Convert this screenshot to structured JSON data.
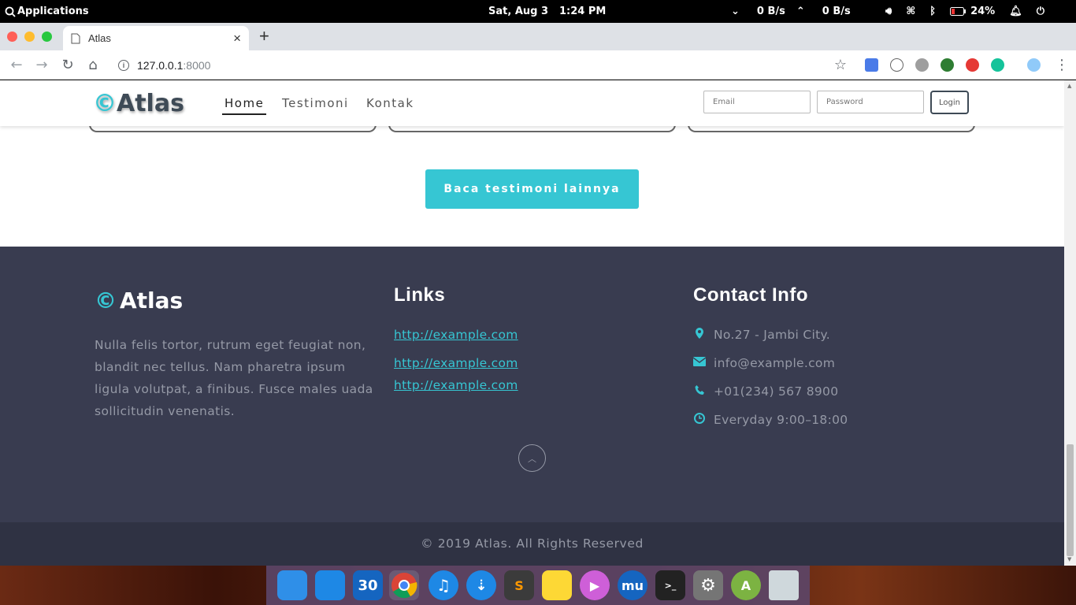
{
  "os_bar": {
    "apps_label": "Applications",
    "date": "Sat, Aug  3",
    "time": "1:24 PM",
    "net_down": "0 B/s",
    "net_up": "0 B/s",
    "battery": "24%"
  },
  "browser": {
    "tab_title": "Atlas",
    "url_host": "127.0.0.1",
    "url_port": ":8000"
  },
  "navbar": {
    "brand_symbol": "©",
    "brand_name": "Atlas",
    "links": [
      "Home",
      "Testimoni",
      "Kontak"
    ],
    "email_placeholder": "Email",
    "password_placeholder": "Password",
    "login_label": "Login"
  },
  "cta_label": "Baca testimoni lainnya",
  "footer": {
    "brand_symbol": "©",
    "brand_name": "Atlas",
    "description": "Nulla felis tortor, rutrum eget feugiat non, blandit nec tellus. Nam pharetra ipsum ligula volutpat, a finibus. Fusce males uada sollicitudin venenatis.",
    "links_heading": "Links",
    "links": [
      "http://example.com",
      "http://example.com",
      "http://example.com"
    ],
    "contact_heading": "Contact Info",
    "contact": {
      "address": "No.27 - Jambi City.",
      "email": "info@example.com",
      "phone": "+01(234) 567 8900",
      "hours": "Everyday 9:00–18:00"
    },
    "copyright": "© 2019 Atlas. All Rights Reserved"
  },
  "dock": {
    "calendar_day": "30"
  },
  "colors": {
    "accent": "#36c6d3",
    "footer_bg": "#393c50",
    "copyright_bg": "#2f3243",
    "brand_text": "#3e4a56"
  }
}
